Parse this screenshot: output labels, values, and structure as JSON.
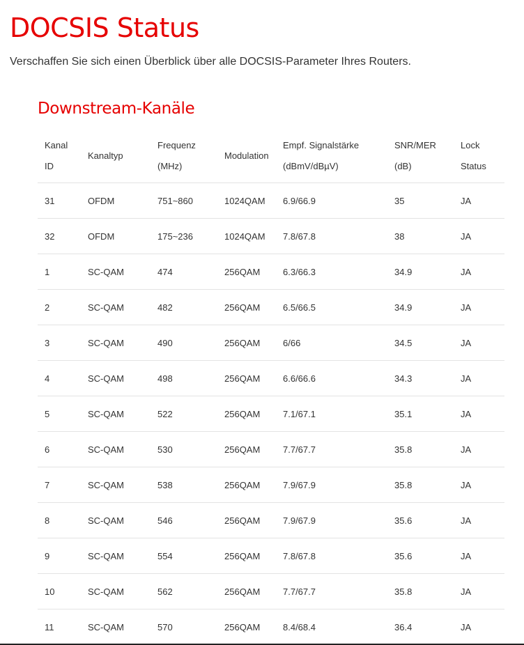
{
  "page": {
    "title": "DOCSIS Status",
    "subtitle": "Verschaffen Sie sich einen Überblick über alle DOCSIS-Parameter Ihres Routers."
  },
  "downstream": {
    "title": "Downstream-Kanäle",
    "headers": [
      [
        "Kanal",
        "ID"
      ],
      [
        "Kanaltyp"
      ],
      [
        "Frequenz",
        "(MHz)"
      ],
      [
        "Modulation"
      ],
      [
        "Empf. Signalstärke",
        "(dBmV/dBµV)"
      ],
      [
        "SNR/MER",
        "(dB)"
      ],
      [
        "Lock",
        "Status"
      ]
    ],
    "rows": [
      [
        "31",
        "OFDM",
        "751~860",
        "1024QAM",
        "6.9/66.9",
        "35",
        "JA"
      ],
      [
        "32",
        "OFDM",
        "175~236",
        "1024QAM",
        "7.8/67.8",
        "38",
        "JA"
      ],
      [
        "1",
        "SC-QAM",
        "474",
        "256QAM",
        "6.3/66.3",
        "34.9",
        "JA"
      ],
      [
        "2",
        "SC-QAM",
        "482",
        "256QAM",
        "6.5/66.5",
        "34.9",
        "JA"
      ],
      [
        "3",
        "SC-QAM",
        "490",
        "256QAM",
        "6/66",
        "34.5",
        "JA"
      ],
      [
        "4",
        "SC-QAM",
        "498",
        "256QAM",
        "6.6/66.6",
        "34.3",
        "JA"
      ],
      [
        "5",
        "SC-QAM",
        "522",
        "256QAM",
        "7.1/67.1",
        "35.1",
        "JA"
      ],
      [
        "6",
        "SC-QAM",
        "530",
        "256QAM",
        "7.7/67.7",
        "35.8",
        "JA"
      ],
      [
        "7",
        "SC-QAM",
        "538",
        "256QAM",
        "7.9/67.9",
        "35.8",
        "JA"
      ],
      [
        "8",
        "SC-QAM",
        "546",
        "256QAM",
        "7.9/67.9",
        "35.6",
        "JA"
      ],
      [
        "9",
        "SC-QAM",
        "554",
        "256QAM",
        "7.8/67.8",
        "35.6",
        "JA"
      ],
      [
        "10",
        "SC-QAM",
        "562",
        "256QAM",
        "7.7/67.7",
        "35.8",
        "JA"
      ],
      [
        "11",
        "SC-QAM",
        "570",
        "256QAM",
        "8.4/68.4",
        "36.4",
        "JA"
      ]
    ]
  },
  "colors": {
    "accent": "#e60000",
    "text": "#333333",
    "divider": "#e3e3e3"
  }
}
